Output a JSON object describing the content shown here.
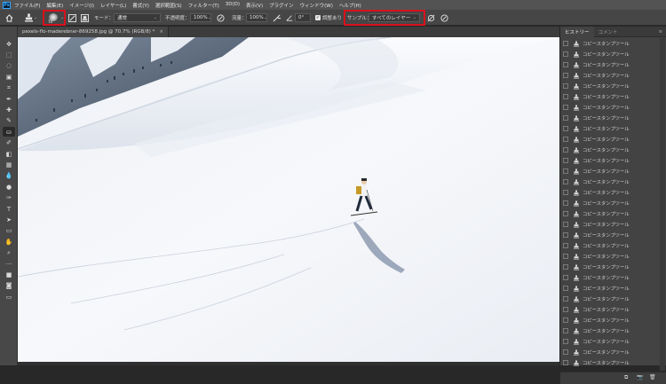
{
  "menu": {
    "items": [
      "ファイル(F)",
      "編集(E)",
      "イメージ(I)",
      "レイヤー(L)",
      "書式(Y)",
      "選択範囲(S)",
      "フィルター(T)",
      "3D(D)",
      "表示(V)",
      "プラグイン",
      "ウィンドウ(W)",
      "ヘルプ(H)"
    ]
  },
  "options": {
    "mode_label": "モード：",
    "mode_value": "通常",
    "opacity_label": "不透明度：",
    "opacity_value": "100%",
    "flow_label": "流量：",
    "flow_value": "100%",
    "angle_value": "0°",
    "aligned_label": "調整あり",
    "sample_label": "サンプル：",
    "sample_value": "すべてのレイヤー",
    "brush_size": "70"
  },
  "document": {
    "tab_title": "pexels-flo-maderebner-869258.jpg @ 70.7% (RGB/8) *",
    "close_label": "×"
  },
  "history": {
    "tab_history": "ヒストリー",
    "tab_comments": "コメント",
    "item_label": "コピースタンプツール",
    "visible_rows": 31
  },
  "icons": {
    "history_row": "stamp-icon",
    "annotation_arrow": "red-arrow-icon"
  },
  "colors": {
    "highlight": "#d8111b",
    "menu_bg": "#535353",
    "panel_bg": "#434343",
    "canvas_snow": "#f3f5f8"
  }
}
